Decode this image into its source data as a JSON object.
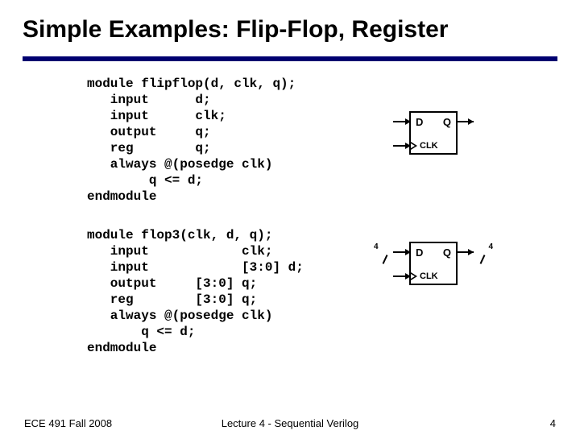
{
  "title": "Simple Examples: Flip-Flop, Register",
  "code1": "module flipflop(d, clk, q);\n   input      d;\n   input      clk;\n   output     q;\n   reg        q;\n   always @(posedge clk)\n        q <= d;\nendmodule",
  "code2": "module flop3(clk, d, q);\n   input            clk;\n   input            [3:0] d;\n   output     [3:0] q;\n   reg        [3:0] q;\n   always @(posedge clk)\n       q <= d;\nendmodule",
  "ff": {
    "d": "D",
    "q": "Q",
    "clk": "CLK",
    "bus": "4"
  },
  "footer": {
    "left": "ECE 491 Fall 2008",
    "center": "Lecture 4 - Sequential Verilog",
    "right": "4"
  }
}
